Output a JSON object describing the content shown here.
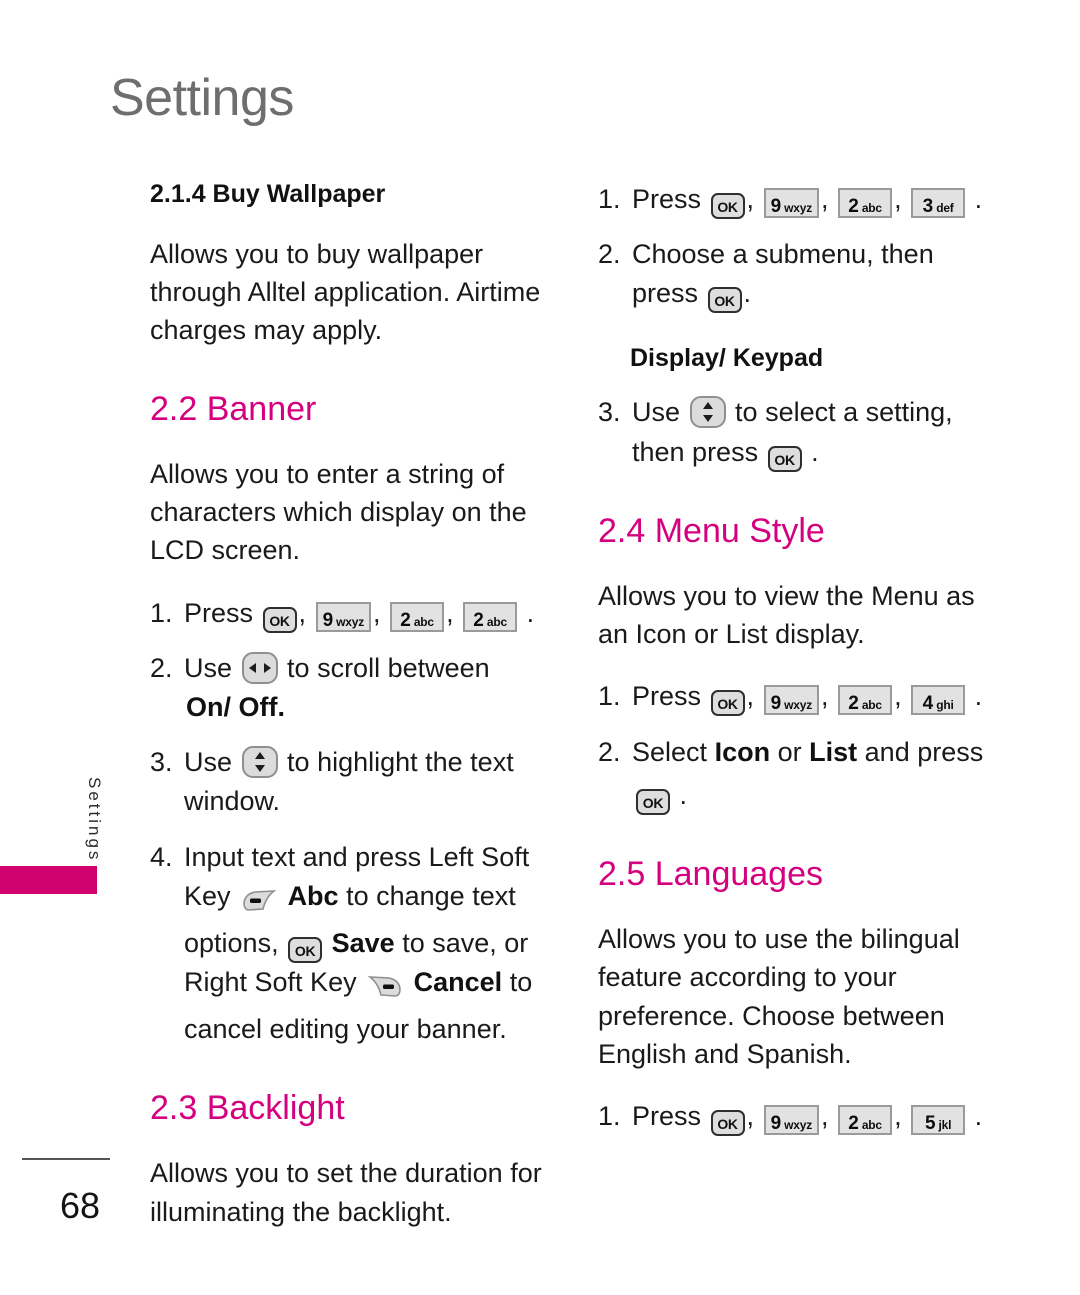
{
  "page": {
    "title": "Settings",
    "side_tab_label": "Settings",
    "page_number": "68",
    "accent_color": "#d4007f",
    "tab_marker_color": "#d1006f",
    "title_color": "#6e6e6e"
  },
  "keys": {
    "ok": "OK",
    "nine": {
      "digit": "9",
      "letters": "wxyz"
    },
    "two": {
      "digit": "2",
      "letters": "abc"
    },
    "three": {
      "digit": "3",
      "letters": "def"
    },
    "four": {
      "digit": "4",
      "letters": "ghi"
    },
    "five": {
      "digit": "5",
      "letters": "jkl"
    }
  },
  "left_column": {
    "buy_wallpaper": {
      "heading": "2.1.4 Buy Wallpaper",
      "body": "Allows you to buy wallpaper through Alltel application. Airtime charges may apply."
    },
    "banner": {
      "heading": "2.2 Banner",
      "body": "Allows you to enter a string of characters which display on the LCD screen.",
      "steps": [
        {
          "num": "1.",
          "text_before": "Press",
          "keys": [
            "ok",
            "nine",
            "two",
            "two"
          ],
          "text_after": "."
        },
        {
          "num": "2.",
          "text_before": "Use",
          "nav": "left-right",
          "text_after": "to scroll between",
          "emphasis": "On/ Off."
        },
        {
          "num": "3.",
          "text_before": "Use",
          "nav": "up-down",
          "text_after": "to highlight the text window."
        },
        {
          "num": "4.",
          "text": "Input text and press Left Soft Key",
          "soft_left_label": "Abc",
          "mid1": "to change text options,",
          "ok_label": "Save",
          "mid2": "to save, or Right Soft Key",
          "soft_right_label": "Cancel",
          "tail": "to cancel editing your banner."
        }
      ]
    },
    "backlight": {
      "heading": "2.3 Backlight",
      "body": "Allows you to set the duration for illuminating the backlight."
    }
  },
  "right_column": {
    "backlight_steps": [
      {
        "num": "1.",
        "text_before": "Press",
        "keys": [
          "ok",
          "nine",
          "two",
          "three"
        ],
        "text_after": "."
      },
      {
        "num": "2.",
        "text_before": "Choose a submenu, then press",
        "keys": [
          "ok"
        ],
        "text_after": "."
      }
    ],
    "display_keypad": {
      "heading": "Display/ Keypad",
      "steps": [
        {
          "num": "3.",
          "text_before": "Use",
          "nav": "up-down",
          "text_after": "to select a setting, then press",
          "keys": [
            "ok"
          ],
          "tail": "."
        }
      ]
    },
    "menu_style": {
      "heading": "2.4 Menu Style",
      "body": "Allows you to view the Menu as an Icon or List display.",
      "steps": [
        {
          "num": "1.",
          "text_before": "Press",
          "keys": [
            "ok",
            "nine",
            "two",
            "four"
          ],
          "text_after": "."
        },
        {
          "num": "2.",
          "text_before": "Select",
          "bold1": "Icon",
          "mid": "or",
          "bold2": "List",
          "text_after": "and press",
          "keys": [
            "ok"
          ],
          "tail": "."
        }
      ]
    },
    "languages": {
      "heading": "2.5 Languages",
      "body": "Allows you to use the bilingual feature according to your preference. Choose between English and Spanish.",
      "steps": [
        {
          "num": "1.",
          "text_before": "Press",
          "keys": [
            "ok",
            "nine",
            "two",
            "five"
          ],
          "text_after": "."
        }
      ]
    }
  }
}
